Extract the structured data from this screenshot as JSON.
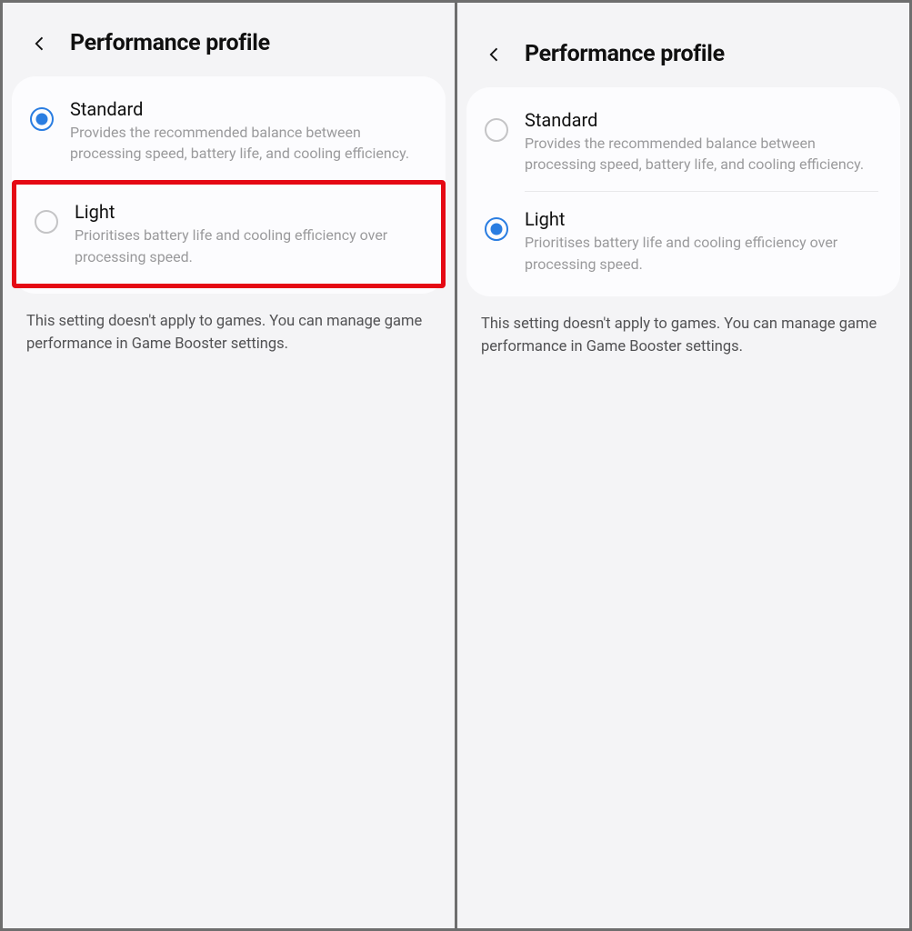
{
  "screens": [
    {
      "title": "Performance profile",
      "selected": "standard",
      "highlight": "light",
      "options": {
        "standard": {
          "title": "Standard",
          "desc": "Provides the recommended balance between processing speed, battery life, and cooling efficiency."
        },
        "light": {
          "title": "Light",
          "desc": "Prioritises battery life and cooling efficiency over processing speed."
        }
      },
      "footnote": "This setting doesn't apply to games. You can manage game performance in Game Booster settings."
    },
    {
      "title": "Performance profile",
      "selected": "light",
      "highlight": null,
      "options": {
        "standard": {
          "title": "Standard",
          "desc": "Provides the recommended balance between processing speed, battery life, and cooling efficiency."
        },
        "light": {
          "title": "Light",
          "desc": "Prioritises battery life and cooling efficiency over processing speed."
        }
      },
      "footnote": "This setting doesn't apply to games. You can manage game performance in Game Booster settings."
    }
  ]
}
